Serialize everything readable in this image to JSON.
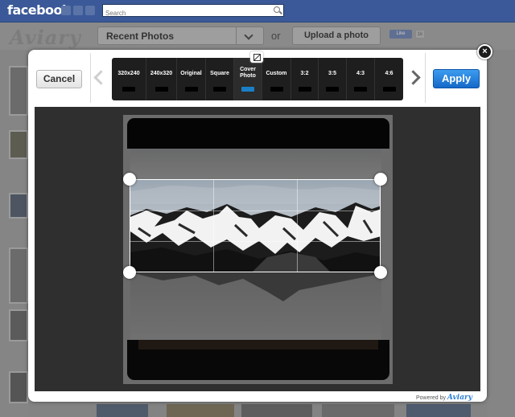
{
  "facebook": {
    "logo": "facebook",
    "search_placeholder": "Search",
    "icons": [
      "friends-icon",
      "messages-icon",
      "notifications-icon"
    ]
  },
  "app": {
    "logo": "Aviary",
    "album_select": "Recent Photos",
    "or_text": "or",
    "upload_button": "Upload a photo",
    "like_button": "Like",
    "like_count": "1k"
  },
  "editor": {
    "cancel_label": "Cancel",
    "apply_label": "Apply",
    "close_label": "×",
    "presets": [
      {
        "label": "320x240",
        "active": false
      },
      {
        "label": "240x320",
        "active": false
      },
      {
        "label": "Original",
        "active": false
      },
      {
        "label": "Square",
        "active": false
      },
      {
        "label": "Cover Photo",
        "active": true
      },
      {
        "label": "Custom",
        "active": false
      },
      {
        "label": "3:2",
        "active": false
      },
      {
        "label": "3:5",
        "active": false
      },
      {
        "label": "4:3",
        "active": false
      },
      {
        "label": "4:6",
        "active": false
      }
    ],
    "powered_by": "Powered by",
    "powered_brand": "Aviary"
  },
  "colors": {
    "facebook_blue": "#3b5998",
    "apply_blue": "#1d7ad8",
    "active_preset_indicator": "#1a7fc7"
  }
}
